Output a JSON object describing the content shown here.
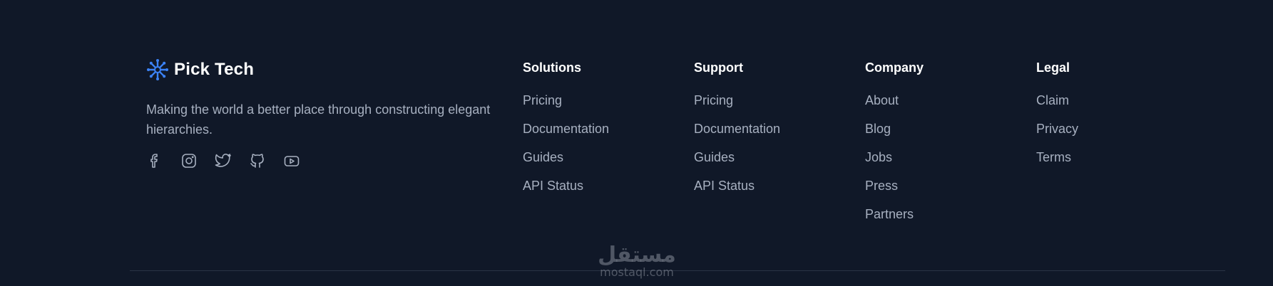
{
  "brand": {
    "name": "Pick Tech",
    "tagline": "Making the world a better place through constructing elegant hierarchies.",
    "logo_icon": "asterisk-logo-icon",
    "accent_color": "#3b82f6"
  },
  "socials": [
    {
      "icon": "facebook-icon",
      "name": "Facebook"
    },
    {
      "icon": "instagram-icon",
      "name": "Instagram"
    },
    {
      "icon": "twitter-icon",
      "name": "Twitter"
    },
    {
      "icon": "github-icon",
      "name": "GitHub"
    },
    {
      "icon": "youtube-icon",
      "name": "YouTube"
    }
  ],
  "columns": {
    "solutions": {
      "title": "Solutions",
      "links": [
        "Pricing",
        "Documentation",
        "Guides",
        "API Status"
      ]
    },
    "support": {
      "title": "Support",
      "links": [
        "Pricing",
        "Documentation",
        "Guides",
        "API Status"
      ]
    },
    "company": {
      "title": "Company",
      "links": [
        "About",
        "Blog",
        "Jobs",
        "Press",
        "Partners"
      ]
    },
    "legal": {
      "title": "Legal",
      "links": [
        "Claim",
        "Privacy",
        "Terms"
      ]
    }
  },
  "watermark": {
    "arabic": "مستقل",
    "latin": "mostaql.com"
  },
  "colors": {
    "background": "#101828",
    "heading": "#ffffff",
    "link": "#a7b0c0"
  }
}
